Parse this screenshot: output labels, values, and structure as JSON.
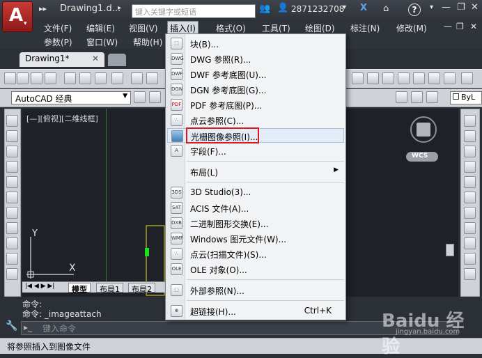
{
  "titlebar": {
    "doc_title": "Drawing1.d...",
    "search_placeholder": "键入关键字或短语",
    "user_id": "2871232708",
    "help_label": "?"
  },
  "menus": [
    "文件(F)",
    "编辑(E)",
    "视图(V)",
    "插入(I)",
    "格式(O)",
    "工具(T)",
    "绘图(D)",
    "标注(N)",
    "修改(M)",
    "参数(P)",
    "窗口(W)",
    "帮助(H)"
  ],
  "tabs": {
    "active": "Drawing1*"
  },
  "workspace": {
    "selected": "AutoCAD 经典"
  },
  "layer": {
    "value": "ByL"
  },
  "viewport": {
    "label": "[—][俯视][二维线框]",
    "wcs": "WCS",
    "axis_y": "Y",
    "axis_x": "X"
  },
  "layout_tabs": [
    "模型",
    "布局1",
    "布局2"
  ],
  "command": {
    "line1": "命令:",
    "line2": "命令:  _imageattach",
    "input_placeholder": "键入命令"
  },
  "status": "将参照插入到图像文件",
  "dropdown": {
    "items": [
      {
        "label": "块(B)...",
        "icon": "block-icon"
      },
      {
        "label": "DWG 参照(R)...",
        "icon": "dwg-icon"
      },
      {
        "label": "DWF 参考底图(U)...",
        "icon": "dwf-icon"
      },
      {
        "label": "DGN 参考底图(G)...",
        "icon": "dgn-icon"
      },
      {
        "label": "PDF 参考底图(P)...",
        "icon": "pdf-icon"
      },
      {
        "label": "点云参照(C)...",
        "icon": "point-cloud-icon"
      },
      {
        "label": "光栅图像参照(I)...",
        "icon": "raster-image-icon",
        "highlighted": true
      },
      {
        "label": "字段(F)...",
        "icon": "field-icon"
      },
      {
        "label": "布局(L)",
        "icon": "",
        "submenu": true
      },
      {
        "label": "3D Studio(3)...",
        "icon": "3ds-icon"
      },
      {
        "label": "ACIS 文件(A)...",
        "icon": "acis-icon"
      },
      {
        "label": "二进制图形交换(E)...",
        "icon": "dxb-icon"
      },
      {
        "label": "Windows 图元文件(W)...",
        "icon": "wmf-icon"
      },
      {
        "label": "点云(扫描文件)(S)...",
        "icon": "point-cloud-scan-icon"
      },
      {
        "label": "OLE 对象(O)...",
        "icon": "ole-icon"
      },
      {
        "label": "外部参照(N)...",
        "icon": "xref-icon"
      },
      {
        "label": "超链接(H)...",
        "icon": "hyperlink-icon",
        "shortcut": "Ctrl+K"
      }
    ]
  },
  "watermark": {
    "brand": "Baidu 经验",
    "url": "jingyan.baidu.com"
  }
}
